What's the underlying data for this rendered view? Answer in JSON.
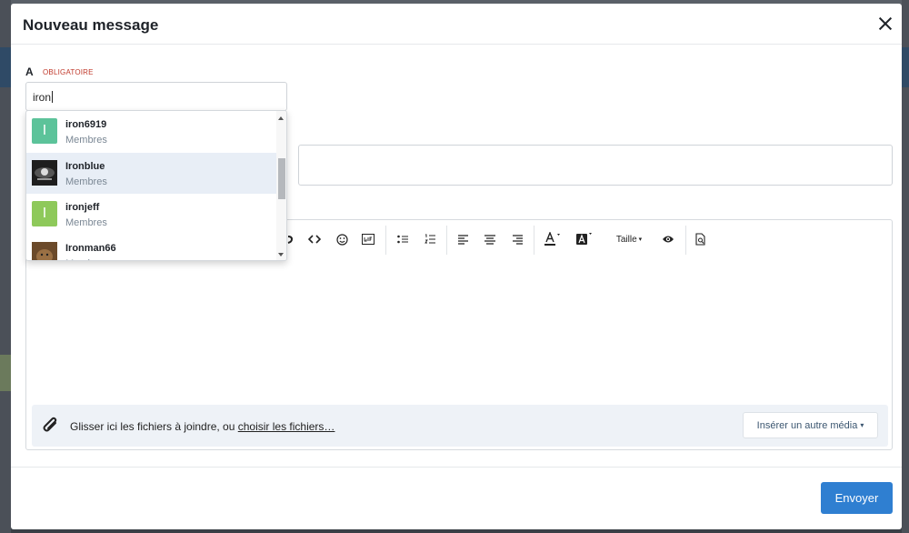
{
  "modal": {
    "title": "Nouveau message",
    "close_icon": "close-icon"
  },
  "recipient": {
    "label": "A",
    "required_text": "OBLIGATOIRE",
    "value": "iron"
  },
  "autocomplete": {
    "items": [
      {
        "name": "iron6919",
        "role": "Membres",
        "avatar_letter": "I",
        "avatar_color": "#5cc39a",
        "highlighted": false
      },
      {
        "name": "Ironblue",
        "role": "Membres",
        "avatar_letter": "",
        "avatar_color": "#1e1e1e",
        "highlighted": true
      },
      {
        "name": "ironjeff",
        "role": "Membres",
        "avatar_letter": "I",
        "avatar_color": "#8ec95a",
        "highlighted": false
      },
      {
        "name": "Ironman66",
        "role": "Membres",
        "avatar_letter": "",
        "avatar_color": "#7a5a3a",
        "highlighted": false
      }
    ]
  },
  "toolbar": {
    "size_label": "Taille"
  },
  "attachments": {
    "text": "Glisser ici les fichiers à joindre, ou ",
    "link": "choisir les fichiers…",
    "insert_button": "Insérer un autre média"
  },
  "send_button": "Envoyer",
  "colors": {
    "primary": "#2f7fd1",
    "required": "#c0392b",
    "highlight": "#e8eef6"
  }
}
